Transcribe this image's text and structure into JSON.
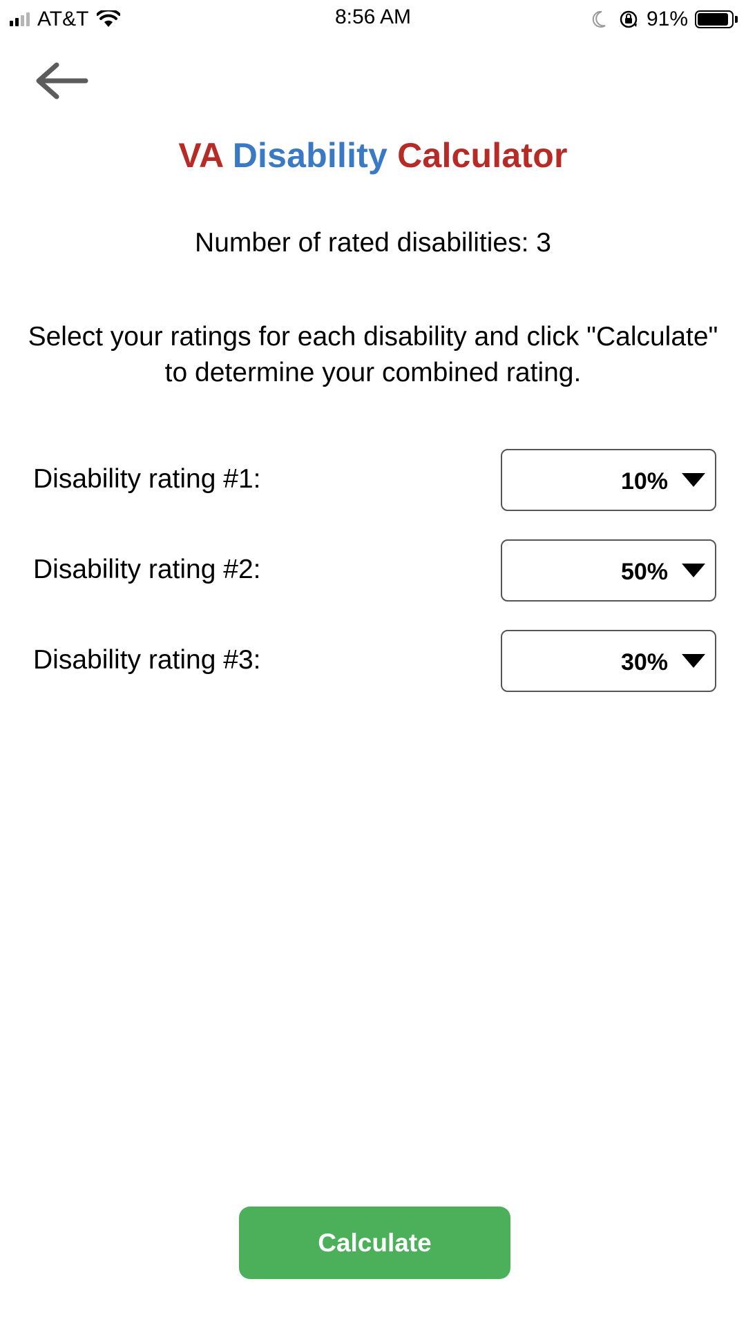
{
  "status_bar": {
    "carrier": "AT&T",
    "time": "8:56 AM",
    "battery_percent": "91%",
    "icons": [
      "signal-icon",
      "wifi-icon",
      "moon-icon",
      "orientation-lock-icon",
      "battery-icon"
    ]
  },
  "header": {
    "back_icon": "back-arrow-icon",
    "title_part1": "VA",
    "title_part2": "Disability",
    "title_part3": "Calculator",
    "title_colors": {
      "red": "#b72b26",
      "blue": "#3a7ac4"
    }
  },
  "main": {
    "count_text": "Number of rated disabilities: 3",
    "instructions": "Select your ratings for each disability and click \"Calculate\" to determine your combined rating.",
    "ratings": [
      {
        "label": "Disability rating #1:",
        "value": "10%"
      },
      {
        "label": "Disability rating #2:",
        "value": "50%"
      },
      {
        "label": "Disability rating #3:",
        "value": "30%"
      }
    ],
    "calculate_label": "Calculate",
    "calculate_color": "#4caf5a"
  }
}
